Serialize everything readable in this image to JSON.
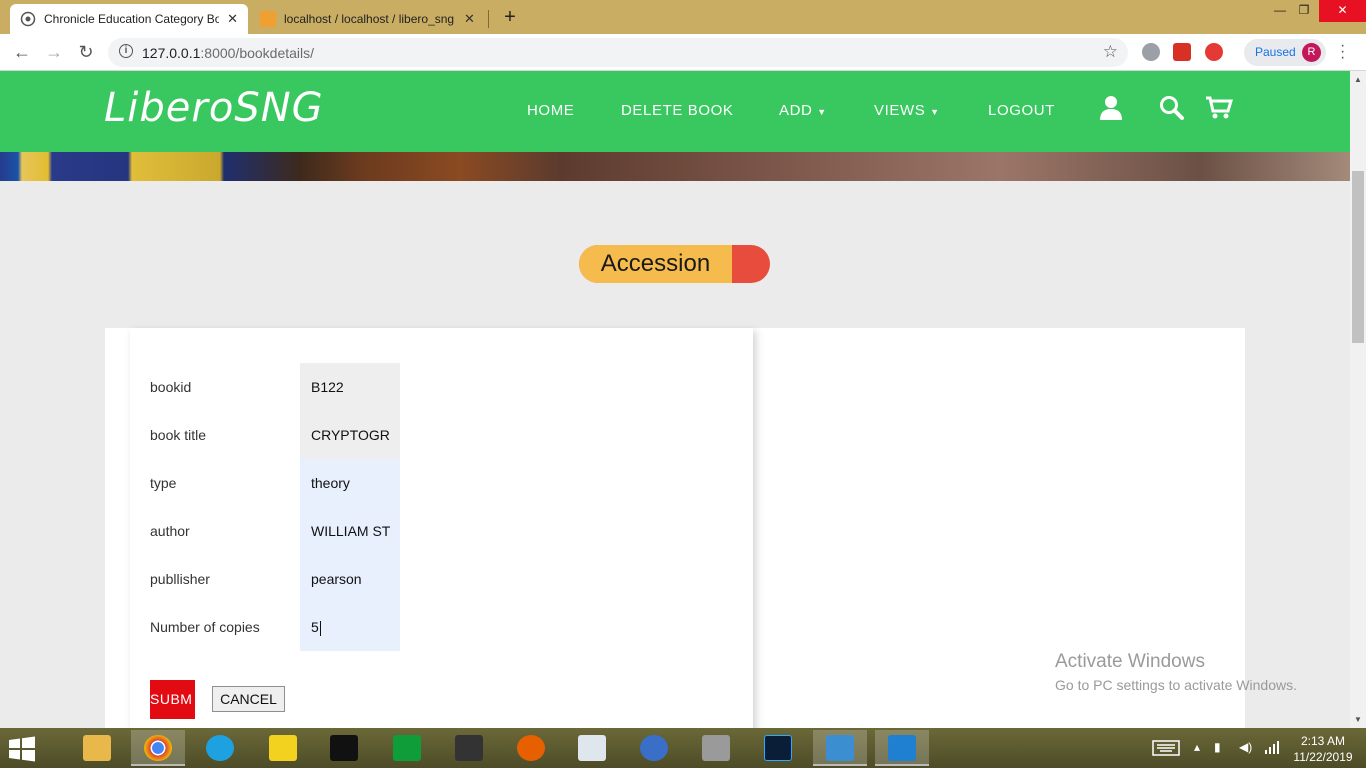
{
  "browser": {
    "tabs": [
      {
        "title": "Chronicle Education Category Bo",
        "active": true
      },
      {
        "title": "localhost / localhost / libero_sng",
        "active": false
      }
    ],
    "url_host": "127.0.0.1",
    "url_path": ":8000/bookdetails/",
    "profile_status": "Paused",
    "profile_initial": "R"
  },
  "site": {
    "logo": "LiberoSNG",
    "nav": {
      "home": "HOME",
      "delete_book": "DELETE BOOK",
      "add": "ADD",
      "views": "VIEWS",
      "logout": "LOGOUT"
    },
    "brand_color": "#38c85f"
  },
  "section_title": "Accession",
  "form": {
    "fields": [
      {
        "label": "bookid",
        "value": "B122"
      },
      {
        "label": "book title",
        "value": "CRYPTOGR"
      },
      {
        "label": "type",
        "value": "theory"
      },
      {
        "label": "author",
        "value": "WILLIAM ST"
      },
      {
        "label": "publlisher",
        "value": "pearson"
      },
      {
        "label": "Number of copies",
        "value": "5"
      }
    ],
    "submit_label": "SUBM",
    "cancel_label": "CANCEL"
  },
  "watermark": {
    "line1": "Activate Windows",
    "line2": "Go to PC settings to activate Windows."
  },
  "taskbar": {
    "time": "2:13 AM",
    "date": "11/22/2019"
  }
}
